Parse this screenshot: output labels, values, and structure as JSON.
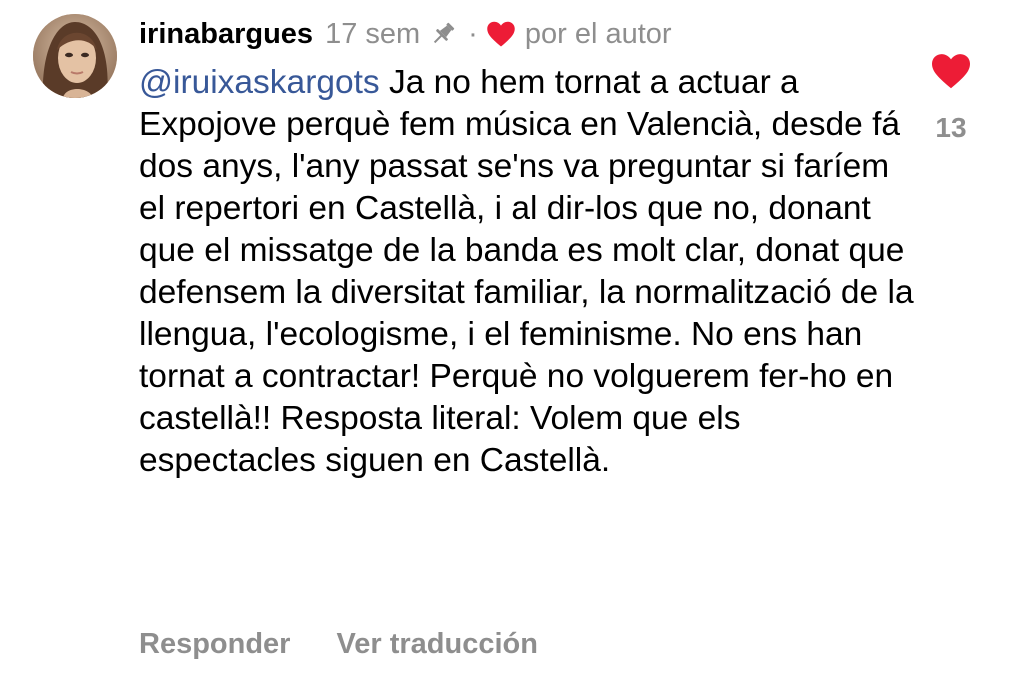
{
  "colors": {
    "heart": "#ed1c36",
    "mention": "#385898",
    "muted": "#8e8e8e"
  },
  "comment": {
    "username": "irinabargues",
    "time": "17 sem",
    "separator": "·",
    "by_author": "por el autor",
    "mention": "@iruixaskargots",
    "text": " Ja no hem tornat a actuar a Expojove perquè fem música en Valencià, desde fá dos anys, l'any passat se'ns va preguntar si faríem el repertori en Castellà, i al dir-los que no, donant que el missatge de la banda es molt clar, donat que defensem la diversitat familiar, la normalització de la llengua, l'ecologisme, i el feminisme. No ens han tornat a contractar! Perquè no volguerem fer-ho en castellà!! Resposta literal: Volem que els espectacles siguen en Castellà.",
    "likes": "13"
  },
  "actions": {
    "reply": "Responder",
    "translate": "Ver traducción"
  },
  "icons": {
    "pin": "pin-icon",
    "author_heart": "heart-icon",
    "like": "heart-icon"
  }
}
